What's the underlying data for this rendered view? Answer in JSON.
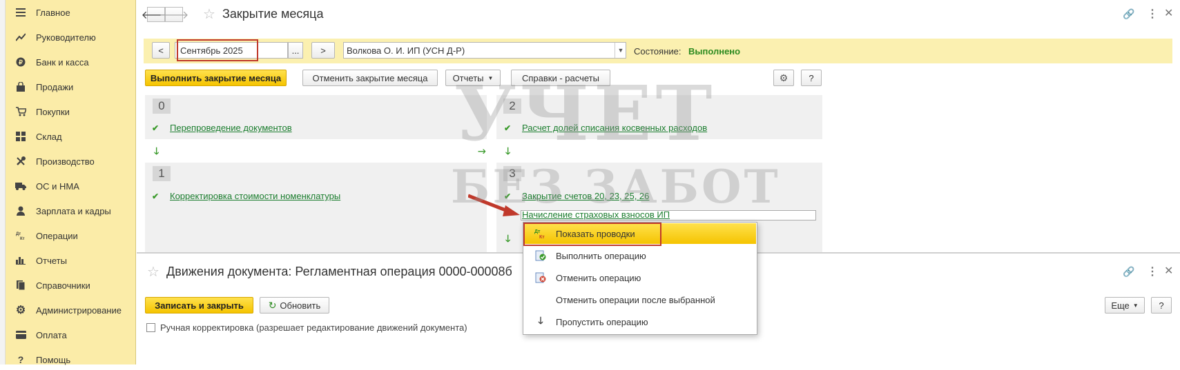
{
  "sidebar": {
    "items": [
      {
        "label": "Главное",
        "icon": "menu-icon"
      },
      {
        "label": "Руководителю",
        "icon": "trend-icon"
      },
      {
        "label": "Банк и касса",
        "icon": "coin-icon"
      },
      {
        "label": "Продажи",
        "icon": "bag-icon"
      },
      {
        "label": "Покупки",
        "icon": "cart-icon"
      },
      {
        "label": "Склад",
        "icon": "grid-icon"
      },
      {
        "label": "Производство",
        "icon": "tools-icon"
      },
      {
        "label": "ОС и НМА",
        "icon": "truck-icon"
      },
      {
        "label": "Зарплата и кадры",
        "icon": "person-icon"
      },
      {
        "label": "Операции",
        "icon": "dt-kt-icon"
      },
      {
        "label": "Отчеты",
        "icon": "bar-chart-icon"
      },
      {
        "label": "Справочники",
        "icon": "books-icon"
      },
      {
        "label": "Администрирование",
        "icon": "gear-icon"
      },
      {
        "label": "Оплата",
        "icon": "card-icon"
      },
      {
        "label": "Помощь",
        "icon": "question-icon"
      }
    ]
  },
  "window1": {
    "title": "Закрытие месяца",
    "period_prev": "<",
    "period_next": ">",
    "period_value": "Сентябрь 2025",
    "period_pick": "...",
    "org_value": "Волкова О. И. ИП (УСН Д-Р)",
    "state_label": "Состояние:",
    "state_value": "Выполнено",
    "btn_run": "Выполнить закрытие месяца",
    "btn_cancel": "Отменить закрытие месяца",
    "btn_reports": "Отчеты",
    "btn_refs": "Справки - расчеты",
    "btn_help": "?",
    "steps": {
      "s0": {
        "num": "0",
        "op": "Перепроведение документов"
      },
      "s1": {
        "num": "1",
        "op": "Корректировка стоимости номенклатуры"
      },
      "s2": {
        "num": "2",
        "op": "Расчет долей списания косвенных расходов"
      },
      "s3": {
        "num": "3",
        "op1": "Закрытие счетов 20, 23, 25, 26",
        "op2": "Начисление страховых взносов ИП"
      }
    }
  },
  "context_menu": {
    "items": [
      {
        "label": "Показать проводки",
        "icon": "dt-kt-icon"
      },
      {
        "label": "Выполнить операцию",
        "icon": "run-op-icon"
      },
      {
        "label": "Отменить операцию",
        "icon": "cancel-op-icon"
      },
      {
        "label": "Отменить операции после выбранной",
        "icon": ""
      },
      {
        "label": "Пропустить операцию",
        "icon": "skip-down-icon"
      }
    ]
  },
  "window2": {
    "title": "Движения документа: Регламентная операция 0000-00008б",
    "btn_save": "Записать и закрыть",
    "btn_refresh": "Обновить",
    "btn_more": "Еще",
    "btn_help": "?",
    "manual_edit": "Ручная корректировка (разрешает редактирование движений документа)"
  },
  "watermark": {
    "line1": "УЧЕТ",
    "line2": "БЕЗ ЗАБОТ"
  },
  "colors": {
    "accent_yellow": "#f5c400",
    "sidebar_bg": "#fbeca8",
    "link_green": "#1b7d2e",
    "highlight_red": "#c0392b"
  }
}
